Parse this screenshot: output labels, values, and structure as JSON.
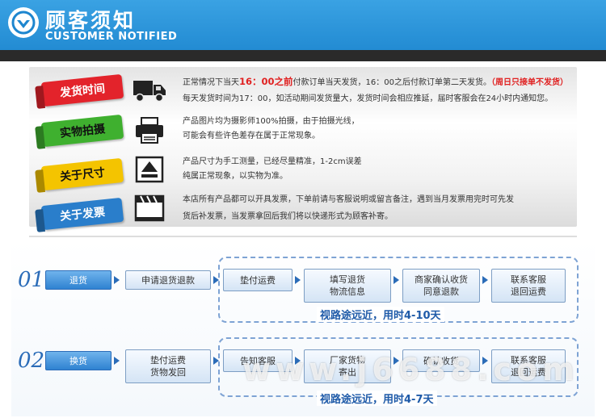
{
  "header": {
    "title_cn": "顾客须知",
    "title_en": "CUSTOMER NOTIFIED",
    "logo_icon": "check-circle-icon"
  },
  "notices": [
    {
      "label": "发货时间",
      "icon": "truck-icon",
      "lines": [
        {
          "part1": "正常情况下当天",
          "red1": "16：00之前",
          "part2": "付款订单当天发货，16：00之后付款订单第二天发货。",
          "red2": "（周日只接单不发货）"
        },
        {
          "text": "每天发货时间为17：00，如活动期间发货量大，发货时间会相应推延，届时客服会在24小时内通知您。"
        }
      ]
    },
    {
      "label": "实物拍摄",
      "icon": "printer-icon",
      "lines": [
        {
          "text": "产品图片均为摄影师100%拍摄，由于拍摄光线，"
        },
        {
          "text": "可能会有些许色差存在属于正常现象。"
        }
      ]
    },
    {
      "label": "关于尺寸",
      "icon": "eject-icon",
      "lines": [
        {
          "text": "产品尺寸为手工测量，已经尽量精准，1-2cm误差"
        },
        {
          "text": "纯属正常现象，以实物为准。"
        }
      ]
    },
    {
      "label": "关于发票",
      "icon": "film-clapper-icon",
      "lines": [
        {
          "text": "本店所有产品都可以开具发票，下单前请与客服说明或留言备注，遇到当月发票用完时可先发"
        },
        {
          "text": "货后补发票，当发票拿回后我们将以快递形式为顾客补寄。"
        }
      ]
    }
  ],
  "flows": [
    {
      "num": "01",
      "steps": [
        "退货",
        "申请退货退款",
        "垫付运费",
        "填写退货\n物流信息",
        "商家确认收货\n同意退款",
        "联系客服\n退回运费"
      ],
      "duration": "视路途远近，用时4-10天"
    },
    {
      "num": "02",
      "steps": [
        "换货",
        "垫付运费\n货物发回",
        "告知客服",
        "厂家货物\n寄出",
        "确认收货",
        "联系客服\n退回运费"
      ],
      "duration": "视路途远近，用时4-7天"
    }
  ],
  "watermark": "www.j6688.com",
  "colors": {
    "header": "#1d86cf",
    "accent": "#2b6cb8",
    "red": "#e02020"
  }
}
